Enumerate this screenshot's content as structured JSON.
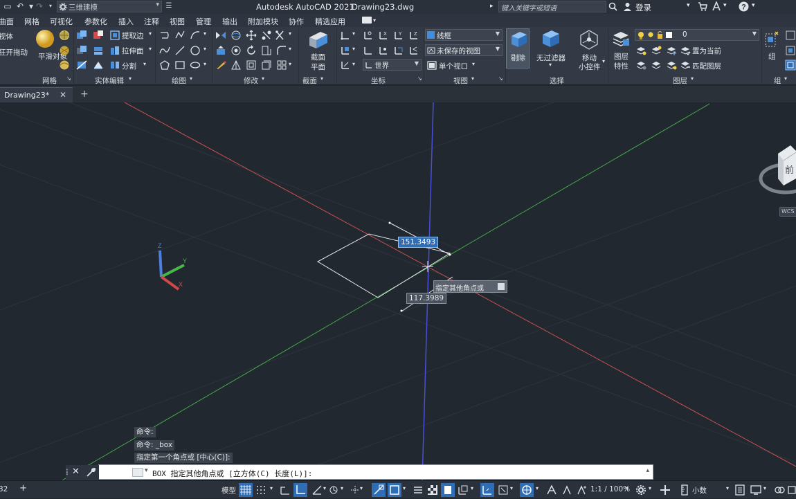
{
  "app": {
    "title": "Autodesk AutoCAD 2021",
    "file": "Drawing23.dwg",
    "workspace": "三维建模",
    "search_placeholder": "键入关键字或短语",
    "login": "登录"
  },
  "menu": [
    "曲面",
    "网格",
    "可视化",
    "参数化",
    "插入",
    "注释",
    "视图",
    "管理",
    "输出",
    "附加模块",
    "协作",
    "精选应用"
  ],
  "ribbon": {
    "left_partial": [
      "视体",
      "狂开拖动"
    ],
    "mesh": {
      "smooth_label": "平滑对象",
      "title": "网格"
    },
    "solid_edit": {
      "extract_edges": "提取边",
      "extrude_faces": "拉伸面",
      "separate": "分割",
      "title": "实体编辑"
    },
    "draw": {
      "title": "绘图"
    },
    "modify": {
      "title": "修改"
    },
    "section": {
      "plane_label_1": "截面",
      "plane_label_2": "平面",
      "title": "截面"
    },
    "coordinates": {
      "ucs_combo": "世界",
      "title": "坐标"
    },
    "view": {
      "visual_style": "线框",
      "saved_view": "未保存的视图",
      "viewport": "单个视口",
      "title": "视图"
    },
    "selection": {
      "cull": "剔除",
      "no_filter": "无过滤器",
      "move_gizmo_1": "移动",
      "move_gizmo_2": "小控件",
      "title": "选择"
    },
    "layers": {
      "layer_props_1": "图层",
      "layer_props_2": "特性",
      "layer_combo": "0",
      "set_current": "置为当前",
      "match_layer": "匹配图层",
      "title": "图层"
    },
    "group": {
      "label": "组",
      "title": "组"
    }
  },
  "doc_tab": {
    "label": "Drawing23*",
    "close": "✕",
    "add": "+"
  },
  "viewcube": {
    "face": "前",
    "wcs": "WCS"
  },
  "dynamic_input": {
    "length": "151.3493",
    "width": "117.3989",
    "prompt": "指定其他角点或"
  },
  "command_history": [
    "命令:",
    "命令: _box",
    "指定第一个角点或 [中心(C)]:"
  ],
  "command_line": {
    "text": "BOX 指定其他角点或 [立方体(C) 长度(L)]:"
  },
  "status": {
    "left_partial": "32",
    "model": "模型",
    "scale": "1:1 / 100%",
    "units": "小数"
  },
  "colors": {
    "background": "#212830",
    "x_axis": "#c8504f",
    "y_axis": "#46a84a",
    "z_axis": "#4a4fd8",
    "ribbon": "#333a45",
    "selection_blue": "#2f6db5"
  }
}
